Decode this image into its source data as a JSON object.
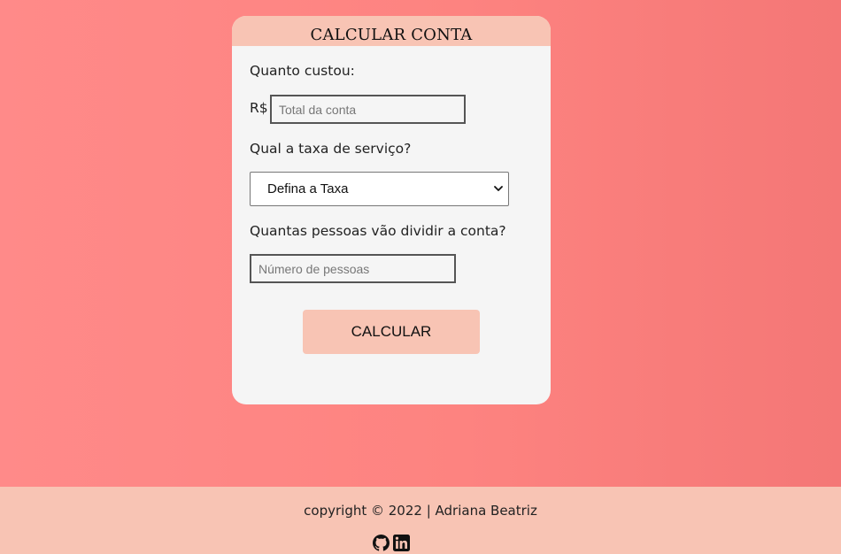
{
  "card": {
    "title": "CALCULAR CONTA",
    "cost_label": "Quanto custou:",
    "currency_symbol": "R$",
    "total_input": {
      "value": "",
      "placeholder": "Total da conta"
    },
    "tax_label": "Qual a taxa de serviço?",
    "tax_select": {
      "selected": "Defina a Taxa"
    },
    "people_label": "Quantas pessoas vão dividir a conta?",
    "people_input": {
      "value": "",
      "placeholder": "Número de pessoas"
    },
    "calculate_button": "CALCULAR"
  },
  "footer": {
    "copyright": "copyright © 2022 | Adriana Beatriz",
    "icons": [
      "github-icon",
      "linkedin-icon"
    ]
  },
  "colors": {
    "background_start": "#ff8a89",
    "background_end": "#f47776",
    "accent": "#f8c4b4",
    "card": "#f5f5f5"
  }
}
